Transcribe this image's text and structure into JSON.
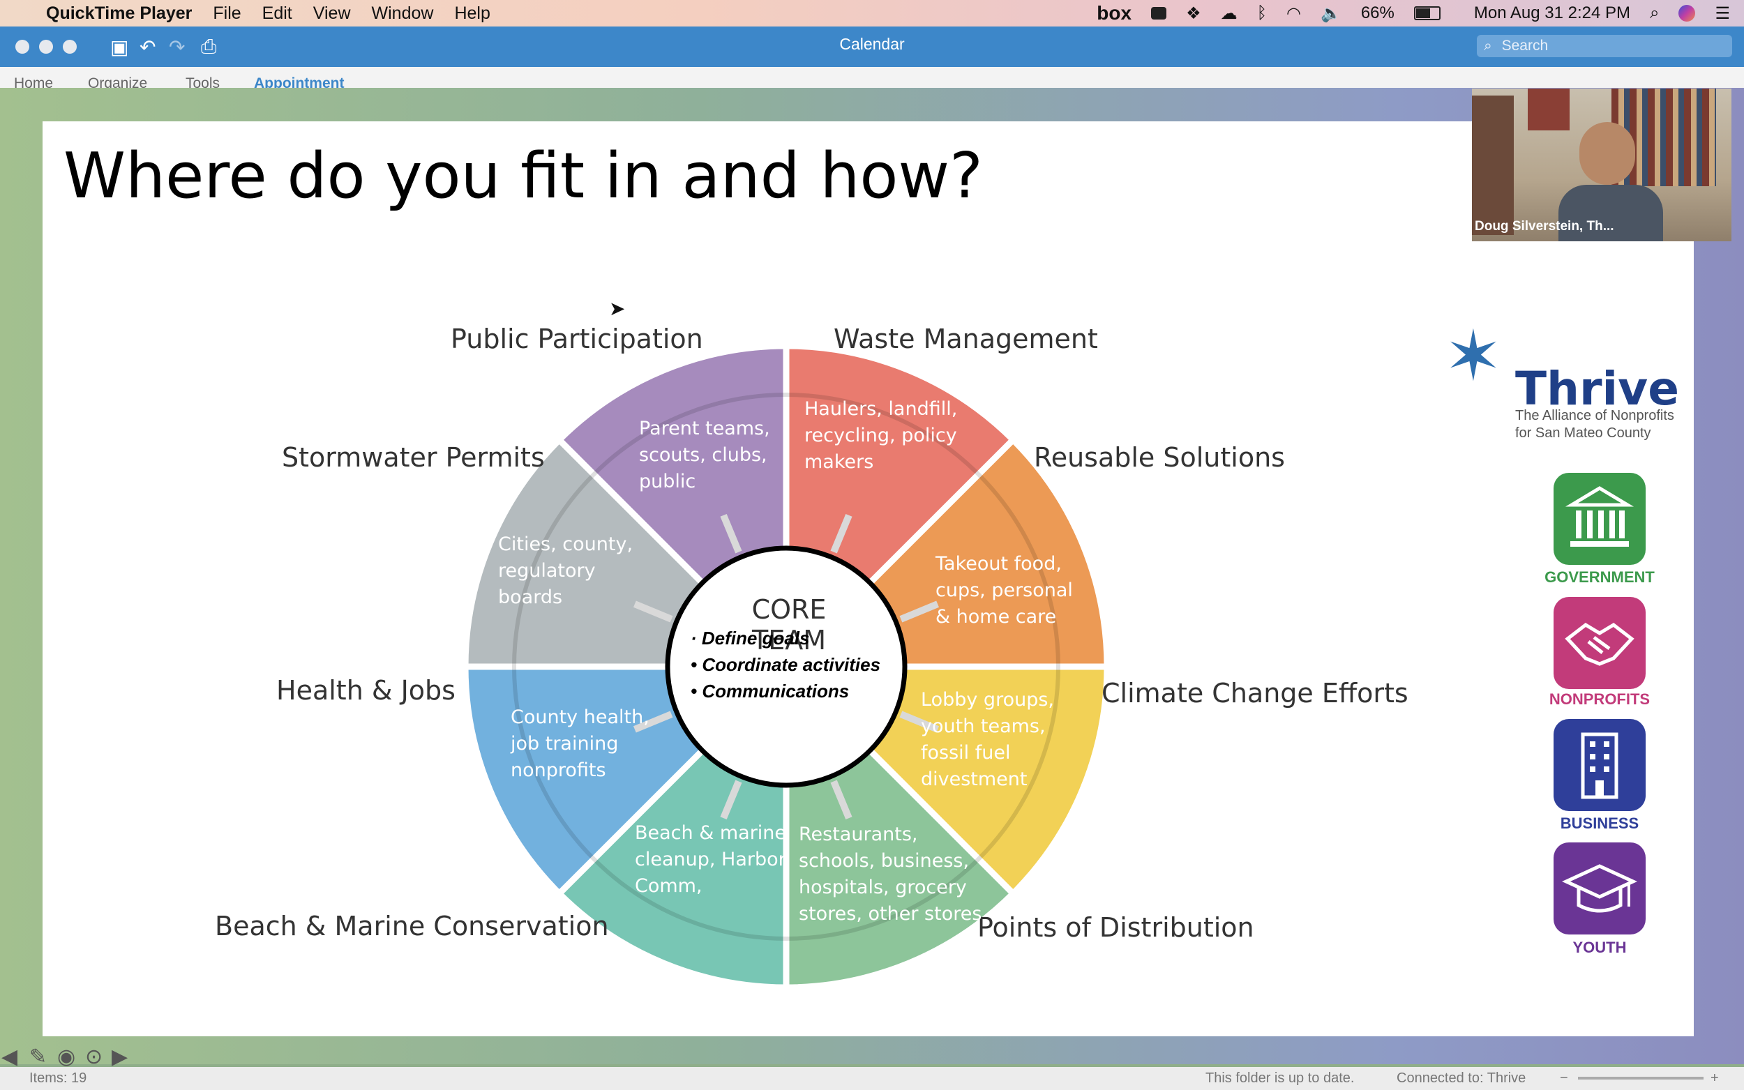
{
  "menubar": {
    "apple": "",
    "app_name": "QuickTime Player",
    "items": [
      "File",
      "Edit",
      "View",
      "Window",
      "Help"
    ],
    "status": {
      "box": "box",
      "battery": "66%",
      "datetime": "Mon Aug 31  2:24 PM"
    }
  },
  "toolbar": {
    "window_title": "Calendar",
    "search_placeholder": "Search"
  },
  "ribbon": {
    "tabs": [
      "Home",
      "Organize",
      "Tools",
      "Appointment"
    ]
  },
  "slide": {
    "title": "Where do you fit in and how?",
    "categories": {
      "public_participation": "Public Participation",
      "waste_management": "Waste Management",
      "stormwater_permits": "Stormwater Permits",
      "reusable_solutions": "Reusable Solutions",
      "health_jobs": "Health & Jobs",
      "climate_change": "Climate Change Efforts",
      "beach_marine": "Beach & Marine Conservation",
      "points_distribution": "Points of Distribution"
    },
    "segments": {
      "purple": "Parent teams,\nscouts, clubs,\npublic",
      "red": "Haulers, landfill,\nrecycling, policy\nmakers",
      "gray": "Cities, county,\nregulatory\nboards",
      "orange": "Takeout food,\ncups, personal\n& home care",
      "blue": "County health,\njob training\nnonprofits",
      "yellow": "Lobby groups,\nyouth teams,\nfossil fuel\ndivestment",
      "teal": "Beach & marine\ncleanup, Harbor\nComm,",
      "green": "Restaurants,\nschools, business,\nhospitals, grocery\nstores, other stores"
    },
    "core": {
      "title": "CORE TEAM",
      "items": [
        "Define goals",
        "Coordinate activities",
        "Communications"
      ]
    },
    "colors": {
      "purple": "#a68bbd",
      "red": "#e97b6f",
      "orange": "#ec9a55",
      "yellow": "#f2d156",
      "green": "#8dc59a",
      "teal": "#78c6b4",
      "blue": "#72b1de",
      "gray": "#b4bbbe"
    }
  },
  "logo": {
    "name": "Thrive",
    "tagline_1": "The  Alliance of Nonprofits",
    "tagline_2": "for San Mateo County"
  },
  "sectors": [
    {
      "label": "GOVERNMENT",
      "icon": "building-columns-icon",
      "color": "#3c9a4c"
    },
    {
      "label": "NONPROFITS",
      "icon": "handshake-icon",
      "color": "#c23b7a"
    },
    {
      "label": "BUSINESS",
      "icon": "office-building-icon",
      "color": "#2f3f9a"
    },
    {
      "label": "YOUTH",
      "icon": "graduation-cap-icon",
      "color": "#6a3595"
    }
  ],
  "webcam": {
    "name": "Doug Silverstein, Th..."
  },
  "status": {
    "items": "Items: 19",
    "folder": "This folder is up to date.",
    "connection": "Connected to: Thrive"
  }
}
